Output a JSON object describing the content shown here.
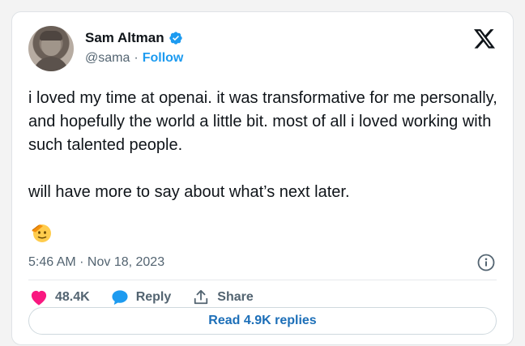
{
  "author": {
    "name": "Sam Altman",
    "handle": "@sama",
    "separator": "·",
    "follow_label": "Follow",
    "verified": true
  },
  "tweet": {
    "paragraphs": [
      "i loved my time at openai. it was transformative for me personally, and hopefully the world a little bit. most of all i loved working with such talented people.",
      "will have more to say about what’s next later."
    ],
    "emoji": "saluting-face",
    "timestamp": "5:46 AM · Nov 18, 2023"
  },
  "actions": {
    "like_count": "48.4K",
    "reply_label": "Reply",
    "share_label": "Share"
  },
  "read_replies_label": "Read 4.9K replies",
  "icons": {
    "logo": "x-logo-icon",
    "verified": "verified-badge-icon",
    "info": "info-icon",
    "like": "heart-icon",
    "reply": "reply-bubble-icon",
    "share": "share-icon"
  },
  "colors": {
    "accent": "#1d9bf0",
    "like": "#f91880",
    "text": "#0f1419",
    "secondary": "#536471"
  }
}
